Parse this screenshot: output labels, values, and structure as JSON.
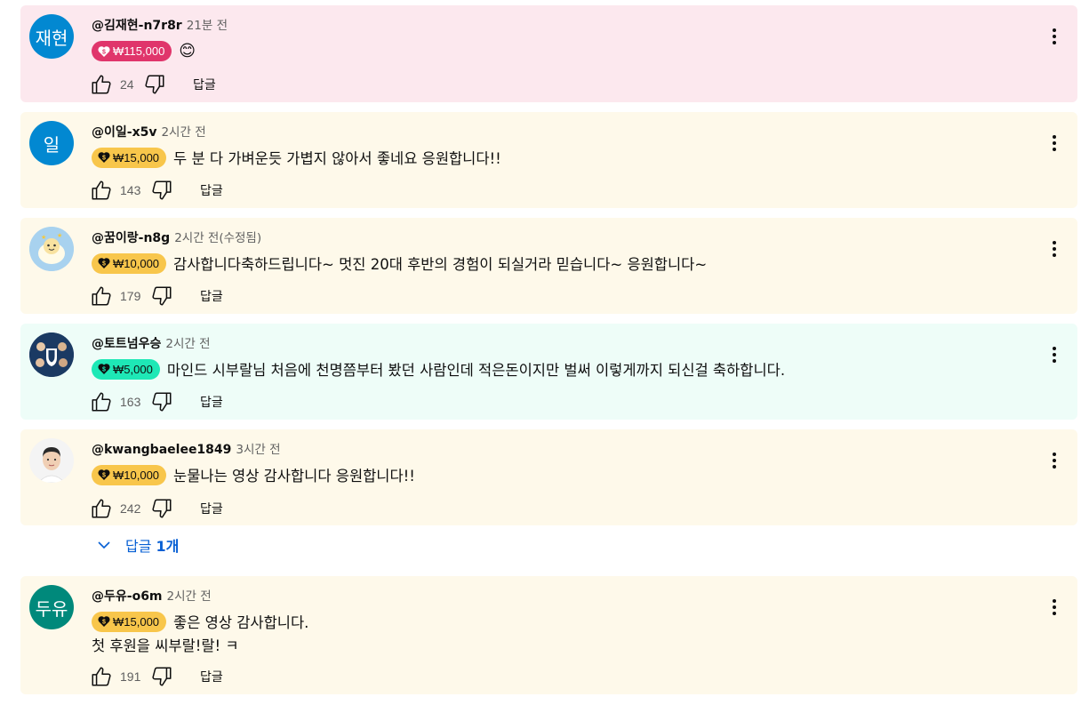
{
  "comments": [
    {
      "avatar_text": "재현",
      "avatar_color": "#0288d1",
      "author": "@김재현-n7r8r",
      "time": "21분 전",
      "amount": "₩115,000",
      "chip_color": "#e0356b",
      "chip_text_color": "#ffffff",
      "text": "😊",
      "likes": "24",
      "reply": "답글",
      "bg": "#fce8ee"
    },
    {
      "avatar_text": "일",
      "avatar_color": "#0288d1",
      "author": "@이일-x5v",
      "time": "2시간 전",
      "amount": "₩15,000",
      "chip_color": "#f8c64b",
      "chip_text_color": "#0f0f0f",
      "text": "두 분 다 가벼운듯 가볍지 않아서 좋네요 응원합니다!!",
      "likes": "143",
      "reply": "답글",
      "bg": "#fef9ea"
    },
    {
      "avatar_text": "",
      "avatar_color": "#a8d2ef",
      "author": "@꿈이랑-n8g",
      "time": "2시간 전(수정됨)",
      "amount": "₩10,000",
      "chip_color": "#f8c64b",
      "chip_text_color": "#0f0f0f",
      "text": "감사합니다축하드립니다~ 멋진 20대 후반의 경험이 되실거라 믿습니다~ 응원합니다~",
      "likes": "179",
      "reply": "답글",
      "bg": "#fef9ea"
    },
    {
      "avatar_text": "",
      "avatar_color": "#1b3a63",
      "author": "@토트넘우승",
      "time": "2시간 전",
      "amount": "₩5,000",
      "chip_color": "#1ee8b6",
      "chip_text_color": "#0f0f0f",
      "text": "마인드 시부랄님 처음에 천명쯤부터 봤던 사람인데 적은돈이지만 벌써 이렇게까지 되신걸 축하합니다.",
      "likes": "163",
      "reply": "답글",
      "bg": "#eefdf8"
    },
    {
      "avatar_text": "",
      "avatar_color": "#f2f2f2",
      "author": "@kwangbaelee1849",
      "time": "3시간 전",
      "amount": "₩10,000",
      "chip_color": "#f8c64b",
      "chip_text_color": "#0f0f0f",
      "text": "눈물나는 영상 감사합니다 응원합니다!!",
      "likes": "242",
      "reply": "답글",
      "bg": "#fef9ea"
    },
    {
      "avatar_text": "두유",
      "avatar_color": "#00897b",
      "author": "@두유-o6m",
      "time": "2시간 전",
      "amount": "₩15,000",
      "chip_color": "#f8c64b",
      "chip_text_color": "#0f0f0f",
      "text": "좋은 영상 감사합니다.",
      "text2": "첫 후원을 씨부랄!랄! ㅋ",
      "likes": "191",
      "reply": "답글",
      "bg": "#fef9ea"
    }
  ],
  "replies_toggle": {
    "label": "답글",
    "count": "1개"
  },
  "icons": {
    "like": "thumb-up-icon",
    "dislike": "thumb-down-icon",
    "more": "more-vert-icon",
    "chevron": "chevron-down-icon",
    "super_thanks": "super-thanks-icon"
  }
}
